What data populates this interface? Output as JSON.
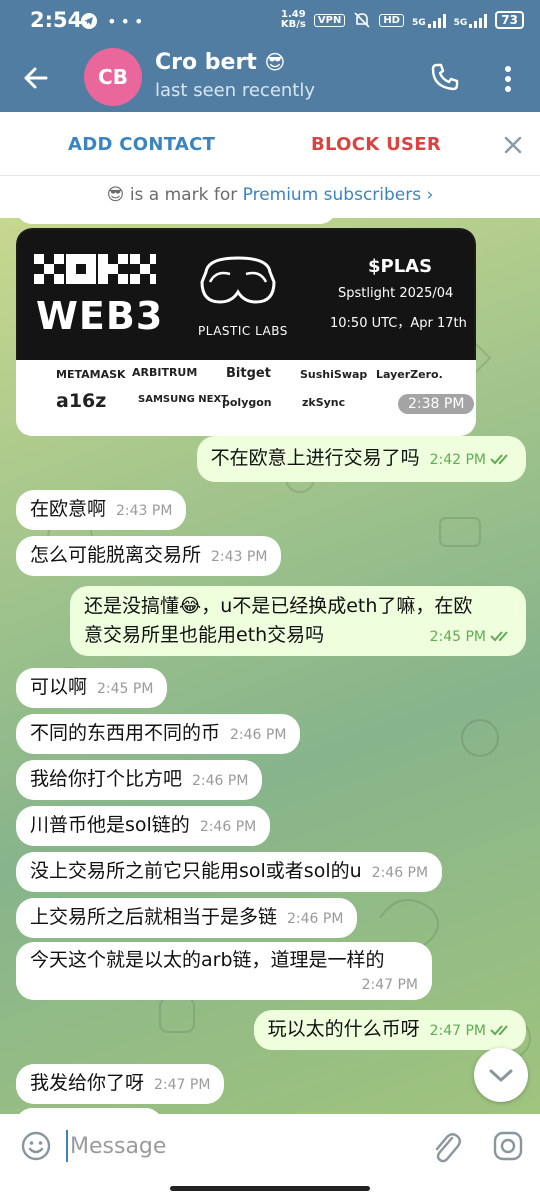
{
  "status_bar": {
    "time": "2:54",
    "left_icons": [
      "telegram-icon",
      "more-icon"
    ],
    "speed_value": "1.49",
    "speed_unit": "KB/s",
    "vpn": "VPN",
    "hd": "HD",
    "network1": "5G",
    "network2": "5G",
    "battery": "73"
  },
  "header": {
    "avatar_initials": "CB",
    "avatar_color": "#e9679a",
    "name": "Cro bert",
    "name_emoji": "😎",
    "status": "last seen recently"
  },
  "action_bar": {
    "add_contact": "ADD CONTACT",
    "block_user": "BLOCK USER"
  },
  "premium_notice": {
    "emoji": "😎",
    "text": "is a mark for",
    "link": "Premium subscribers",
    "arrow": "›"
  },
  "image_message": {
    "brand_line": "WEB3",
    "project": "PLASTIC LABS",
    "ticker": "$PLAS",
    "event": "Spstlight 2025/04",
    "when": "10:50 UTC，Apr 17th",
    "partners": [
      "METAMASK",
      "ARBITRUM",
      "Bitget",
      "SushiSwap",
      "LayerZero.",
      "a16z",
      "SAMSUNG NEXT",
      "polygon",
      "zkSync"
    ],
    "time": "2:38 PM"
  },
  "messages": [
    {
      "dir": "out",
      "text": "不在欧意上进行交易了吗",
      "time": "2:42 PM"
    },
    {
      "dir": "in",
      "text": "在欧意啊",
      "time": "2:43 PM"
    },
    {
      "dir": "in",
      "text": "怎么可能脱离交易所",
      "time": "2:43 PM"
    },
    {
      "dir": "out",
      "text": "还是没搞懂😂，u不是已经换成eth了嘛，在欧",
      "text2": "意交易所里也能用eth交易吗",
      "time": "2:45 PM"
    },
    {
      "dir": "in",
      "text": "可以啊",
      "time": "2:45 PM"
    },
    {
      "dir": "in",
      "text": "不同的东西用不同的币",
      "time": "2:46 PM"
    },
    {
      "dir": "in",
      "text": "我给你打个比方吧",
      "time": "2:46 PM"
    },
    {
      "dir": "in",
      "text": "川普币他是sol链的",
      "time": "2:46 PM"
    },
    {
      "dir": "in",
      "text": "没上交易所之前它只能用sol或者sol的u",
      "time": "2:46 PM"
    },
    {
      "dir": "in",
      "text": "上交易所之后就相当于是多链",
      "time": "2:46 PM"
    },
    {
      "dir": "in",
      "text": "今天这个就是以太的arb链，道理是一样的",
      "time": "2:47 PM"
    },
    {
      "dir": "out",
      "text": "玩以太的什么币呀",
      "time": "2:47 PM"
    },
    {
      "dir": "in",
      "text": "我发给你了呀",
      "time": "2:47 PM"
    }
  ],
  "composer": {
    "placeholder": "Message"
  },
  "colors": {
    "header": "#517da2",
    "outgoing_bubble": "#effedd",
    "incoming_bubble": "#ffffff",
    "link": "#3a85c0",
    "danger": "#d9443f",
    "read_check": "#5fad55"
  }
}
